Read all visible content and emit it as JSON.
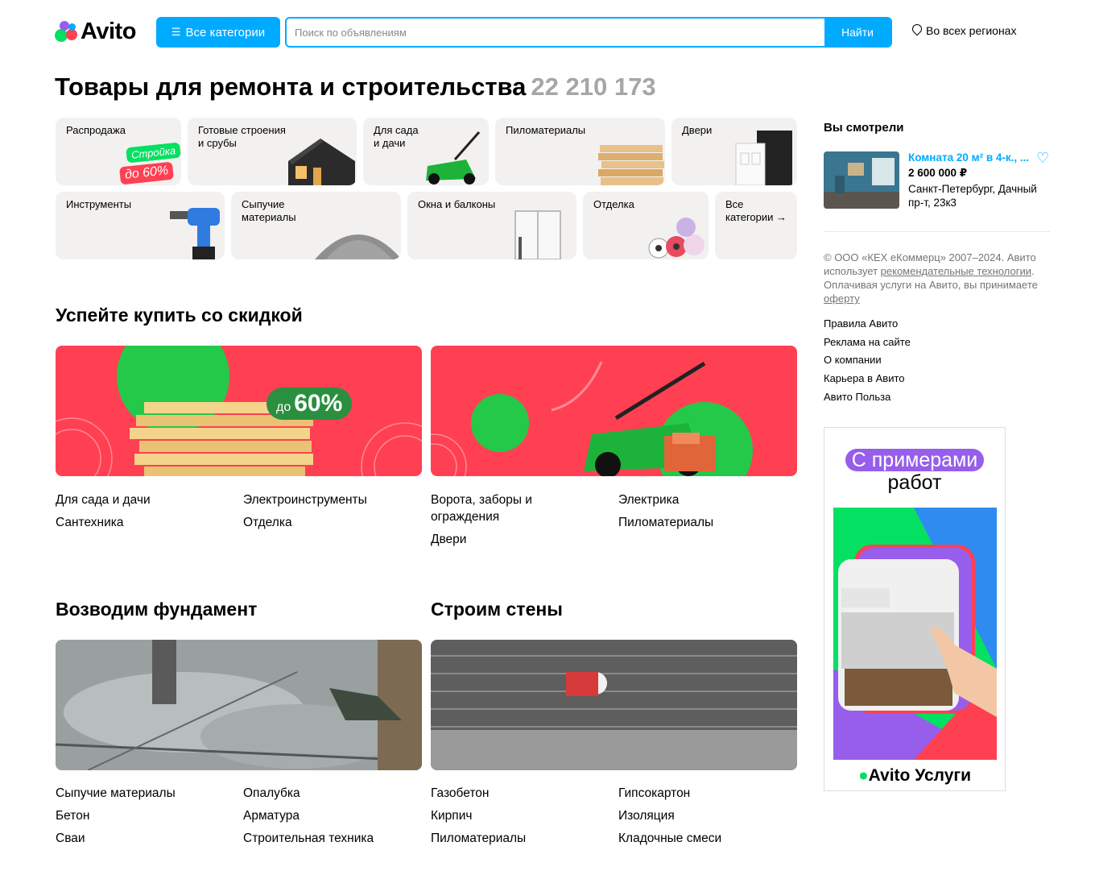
{
  "header": {
    "logo_text": "Avito",
    "categories_button": "Все категории",
    "search_placeholder": "Поиск по объявлениям",
    "search_button": "Найти",
    "region": "Во всех регионах"
  },
  "page": {
    "title": "Товары для ремонта и строительства",
    "count": "22 210 173"
  },
  "tiles": [
    {
      "label": "Распродажа",
      "badge1": "Стройка",
      "badge2": "до 60%"
    },
    {
      "label": "Готовые строения\nи срубы"
    },
    {
      "label": "Для сада\nи дачи"
    },
    {
      "label": "Пиломатериалы"
    },
    {
      "label": "Двери"
    },
    {
      "label": "Инструменты"
    },
    {
      "label": "Сыпучие\nматериалы"
    },
    {
      "label": "Окна и балконы"
    },
    {
      "label": "Отделка"
    },
    {
      "label": "Все\nкатегории →"
    }
  ],
  "sale_section": {
    "title": "Успейте купить со скидкой",
    "banner_left_badge_small": "до",
    "banner_left_badge_big": "60%",
    "left_col1": [
      "Для сада и дачи",
      "Сантехника"
    ],
    "left_col2": [
      "Электроинструменты",
      "Отделка"
    ],
    "right_col1": [
      "Ворота, заборы и ограждения",
      "Двери"
    ],
    "right_col2": [
      "Электрика",
      "Пиломатериалы"
    ]
  },
  "foundation": {
    "title": "Возводим фундамент",
    "col1": [
      "Сыпучие материалы",
      "Бетон",
      "Сваи"
    ],
    "col2": [
      "Опалубка",
      "Арматура",
      "Строительная техника"
    ]
  },
  "walls": {
    "title": "Строим стены",
    "col1": [
      "Газобетон",
      "Кирпич",
      "Пиломатериалы"
    ],
    "col2": [
      "Гипсокартон",
      "Изоляция",
      "Кладочные смеси"
    ]
  },
  "sidebar": {
    "viewed_title": "Вы смотрели",
    "item_title": "Комната 20 м² в 4-к., ...",
    "item_price": "2 600 000 ₽",
    "item_address": "Санкт-Петербург, Дачный пр-т, 23к3",
    "legal_1": "© ООО «КЕХ еКоммерц» 2007–2024.",
    "legal_2": "Авито использует",
    "legal_link1": "рекомендательные технологии",
    "legal_3": ". Оплачивая услуги на Авито, вы принимаете",
    "legal_link2": "оферту",
    "links": [
      "Правила Авито",
      "Реклама на сайте",
      "О компании",
      "Карьера в Авито",
      "Авито Польза"
    ]
  },
  "ad": {
    "pill": "С примерами",
    "sub": "работ",
    "brand": "Avito Услуги"
  },
  "colors": {
    "accent": "#00aaff",
    "promo_red": "#ff4053",
    "promo_green": "#04e061",
    "violet": "#965eeb"
  }
}
